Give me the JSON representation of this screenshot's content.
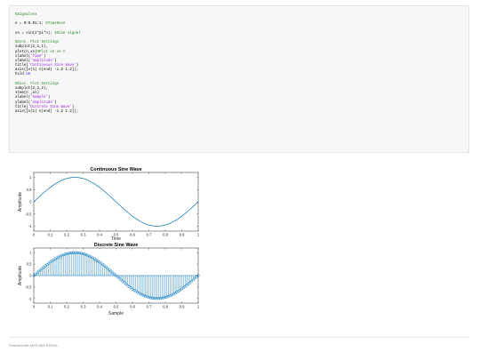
{
  "code": {
    "lines": [
      [
        {
          "t": "%Signalsex",
          "c": "comment"
        }
      ],
      [
        {
          "t": "",
          "c": "plain"
        }
      ],
      [
        {
          "t": "n = 0:0.01:1; ",
          "c": "plain"
        },
        {
          "t": "%Timebase",
          "c": "comment"
        }
      ],
      [
        {
          "t": "",
          "c": "plain"
        }
      ],
      [
        {
          "t": "xn = sin(2*pi*n); ",
          "c": "plain"
        },
        {
          "t": "%Sine signal",
          "c": "comment"
        }
      ],
      [
        {
          "t": "",
          "c": "plain"
        }
      ],
      [
        {
          "t": "%Cont. Plot Settings",
          "c": "comment"
        }
      ],
      [
        {
          "t": "subplot(2,1,1),",
          "c": "plain"
        }
      ],
      [
        {
          "t": "plot(n,xn)",
          "c": "plain"
        },
        {
          "t": "%Plot xn vs n",
          "c": "comment"
        }
      ],
      [
        {
          "t": "xlabel(",
          "c": "plain"
        },
        {
          "t": "'Time'",
          "c": "string"
        },
        {
          "t": ")",
          "c": "plain"
        }
      ],
      [
        {
          "t": "ylabel(",
          "c": "plain"
        },
        {
          "t": "'Amplitude'",
          "c": "string"
        },
        {
          "t": ")",
          "c": "plain"
        }
      ],
      [
        {
          "t": "title(",
          "c": "plain"
        },
        {
          "t": "'Continuous Sine Wave'",
          "c": "string"
        },
        {
          "t": ")",
          "c": "plain"
        }
      ],
      [
        {
          "t": "axis([n(1) n(end) -1.2 1.2]);",
          "c": "plain"
        }
      ],
      [
        {
          "t": "hold ",
          "c": "plain"
        },
        {
          "t": "on",
          "c": "keyword"
        }
      ],
      [
        {
          "t": "",
          "c": "plain"
        }
      ],
      [
        {
          "t": "%Disc. Plot Settings",
          "c": "comment"
        }
      ],
      [
        {
          "t": "subplot(2,1,2),",
          "c": "plain"
        }
      ],
      [
        {
          "t": "stem(n ,xn)",
          "c": "plain"
        }
      ],
      [
        {
          "t": "xlabel(",
          "c": "plain"
        },
        {
          "t": "'Sample'",
          "c": "string"
        },
        {
          "t": ")",
          "c": "plain"
        }
      ],
      [
        {
          "t": "ylabel(",
          "c": "plain"
        },
        {
          "t": "'Amplitude'",
          "c": "string"
        },
        {
          "t": ")",
          "c": "plain"
        }
      ],
      [
        {
          "t": "title(",
          "c": "plain"
        },
        {
          "t": "'Discrete Sine Wave'",
          "c": "string"
        },
        {
          "t": ")",
          "c": "plain"
        }
      ],
      [
        {
          "t": "axis([n(1) n(end) -1.2 1.2]);",
          "c": "plain"
        }
      ]
    ]
  },
  "chart_data": [
    {
      "type": "line",
      "title": "Continuous Sine Wave",
      "xlabel": "Time",
      "ylabel": "Amplitude",
      "xlim": [
        0,
        1
      ],
      "ylim": [
        -1.2,
        1.2
      ],
      "x": {
        "start": 0,
        "step": 0.01,
        "end": 1
      },
      "y": "sin(2*pi*x)",
      "xticks": [
        "0",
        "0.1",
        "0.2",
        "0.3",
        "0.4",
        "0.5",
        "0.6",
        "0.7",
        "0.8",
        "0.9",
        "1"
      ],
      "yticks": [
        "1",
        "0.5",
        "0",
        "-0.5",
        "-1"
      ],
      "color": "#0072bd"
    },
    {
      "type": "stem",
      "title": "Discrete Sine Wave",
      "xlabel": "Sample",
      "ylabel": "Amplitude",
      "xlim": [
        0,
        1
      ],
      "ylim": [
        -1.2,
        1.2
      ],
      "x": {
        "start": 0,
        "step": 0.01,
        "end": 1
      },
      "y": "sin(2*pi*x)",
      "xticks": [
        "0",
        "0.1",
        "0.2",
        "0.3",
        "0.4",
        "0.5",
        "0.6",
        "0.7",
        "0.8",
        "0.9",
        "1"
      ],
      "yticks": [
        "1",
        "0.5",
        "0",
        "-0.5",
        "-1"
      ],
      "color": "#0072bd"
    }
  ],
  "footer": {
    "text": "Published with MATLAB® R2022a"
  }
}
